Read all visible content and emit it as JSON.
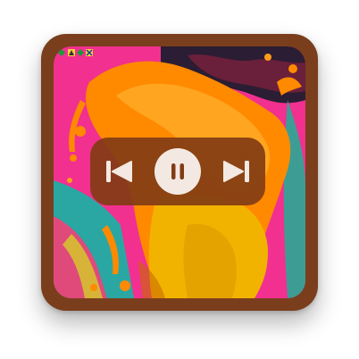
{
  "widget": {
    "frame_color": "#7a3e1d",
    "artwork": {
      "description_icon": "album-art-image",
      "colors": {
        "magenta": "#f2308f",
        "orange": "#ff8a00",
        "yellow": "#f2b300",
        "teal": "#2aa7a3",
        "dark": "#2b1d33"
      }
    },
    "controls": {
      "panel_color": "#823c14",
      "icon_color": "#f3e9e2",
      "previous_icon": "skip-previous-icon",
      "pause_icon": "pause-icon",
      "next_icon": "skip-next-icon"
    }
  }
}
